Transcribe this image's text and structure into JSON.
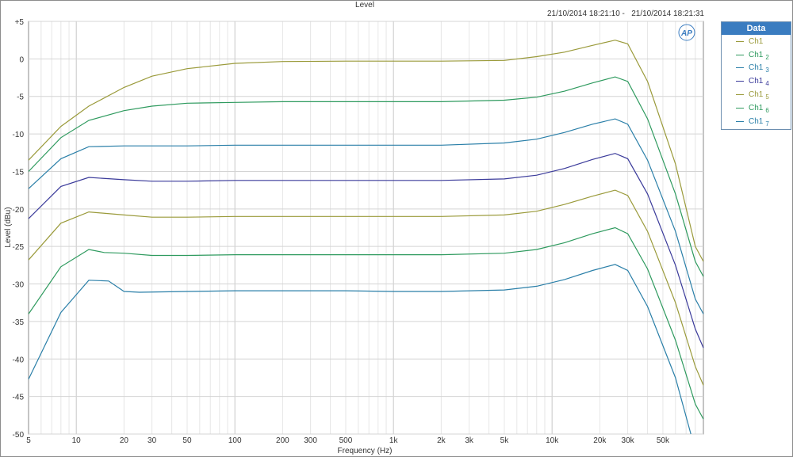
{
  "chart_data": {
    "type": "line",
    "title": "Level",
    "timestamp": "21/10/2014 18:21:10 -   21/10/2014 18:21:31",
    "xlabel": "Frequency (Hz)",
    "ylabel": "Level (dBu)",
    "xscale": "log",
    "xlim": [
      5,
      90000
    ],
    "ylim": [
      -50,
      5
    ],
    "grid": true,
    "legend_position": "right",
    "legend_title": "Data",
    "logo_text": "AP",
    "xticks": [
      {
        "v": 5,
        "label": "5"
      },
      {
        "v": 10,
        "label": "10"
      },
      {
        "v": 20,
        "label": "20"
      },
      {
        "v": 30,
        "label": "30"
      },
      {
        "v": 50,
        "label": "50"
      },
      {
        "v": 100,
        "label": "100"
      },
      {
        "v": 200,
        "label": "200"
      },
      {
        "v": 300,
        "label": "300"
      },
      {
        "v": 500,
        "label": "500"
      },
      {
        "v": 1000,
        "label": "1k"
      },
      {
        "v": 2000,
        "label": "2k"
      },
      {
        "v": 3000,
        "label": "3k"
      },
      {
        "v": 5000,
        "label": "5k"
      },
      {
        "v": 10000,
        "label": "10k"
      },
      {
        "v": 20000,
        "label": "20k"
      },
      {
        "v": 30000,
        "label": "30k"
      },
      {
        "v": 50000,
        "label": "50k"
      }
    ],
    "yticks": [
      {
        "v": 5,
        "label": "+5"
      },
      {
        "v": 0,
        "label": "0"
      },
      {
        "v": -5,
        "label": "-5"
      },
      {
        "v": -10,
        "label": "-10"
      },
      {
        "v": -15,
        "label": "-15"
      },
      {
        "v": -20,
        "label": "-20"
      },
      {
        "v": -25,
        "label": "-25"
      },
      {
        "v": -30,
        "label": "-30"
      },
      {
        "v": -35,
        "label": "-35"
      },
      {
        "v": -40,
        "label": "-40"
      },
      {
        "v": -45,
        "label": "-45"
      },
      {
        "v": -50,
        "label": "-50"
      }
    ],
    "series": [
      {
        "name": "Ch1",
        "sub": "",
        "color": "#9a9a3a",
        "points": [
          [
            5,
            -13.5
          ],
          [
            8,
            -9
          ],
          [
            12,
            -6.3
          ],
          [
            20,
            -3.8
          ],
          [
            30,
            -2.3
          ],
          [
            50,
            -1.3
          ],
          [
            100,
            -0.6
          ],
          [
            200,
            -0.35
          ],
          [
            500,
            -0.3
          ],
          [
            1000,
            -0.3
          ],
          [
            2000,
            -0.3
          ],
          [
            5000,
            -0.2
          ],
          [
            8000,
            0.3
          ],
          [
            12000,
            0.9
          ],
          [
            18000,
            1.8
          ],
          [
            25000,
            2.5
          ],
          [
            30000,
            2.0
          ],
          [
            40000,
            -3
          ],
          [
            60000,
            -14
          ],
          [
            80000,
            -25
          ],
          [
            90000,
            -27
          ]
        ]
      },
      {
        "name": "Ch1",
        "sub": "2",
        "color": "#2e9a5e",
        "points": [
          [
            5,
            -15
          ],
          [
            8,
            -10.5
          ],
          [
            12,
            -8.2
          ],
          [
            20,
            -6.9
          ],
          [
            30,
            -6.3
          ],
          [
            50,
            -5.9
          ],
          [
            100,
            -5.8
          ],
          [
            200,
            -5.7
          ],
          [
            500,
            -5.7
          ],
          [
            1000,
            -5.7
          ],
          [
            2000,
            -5.7
          ],
          [
            5000,
            -5.5
          ],
          [
            8000,
            -5.1
          ],
          [
            12000,
            -4.3
          ],
          [
            18000,
            -3.2
          ],
          [
            25000,
            -2.4
          ],
          [
            30000,
            -3
          ],
          [
            40000,
            -8
          ],
          [
            60000,
            -18
          ],
          [
            80000,
            -27
          ],
          [
            90000,
            -29
          ]
        ]
      },
      {
        "name": "Ch1",
        "sub": "3",
        "color": "#2a7fa8",
        "points": [
          [
            5,
            -17.3
          ],
          [
            8,
            -13.3
          ],
          [
            12,
            -11.7
          ],
          [
            20,
            -11.6
          ],
          [
            50,
            -11.6
          ],
          [
            100,
            -11.5
          ],
          [
            500,
            -11.5
          ],
          [
            1000,
            -11.5
          ],
          [
            2000,
            -11.5
          ],
          [
            5000,
            -11.2
          ],
          [
            8000,
            -10.7
          ],
          [
            12000,
            -9.8
          ],
          [
            18000,
            -8.7
          ],
          [
            25000,
            -8
          ],
          [
            30000,
            -8.7
          ],
          [
            40000,
            -13.5
          ],
          [
            60000,
            -23
          ],
          [
            80000,
            -32
          ],
          [
            90000,
            -34
          ]
        ]
      },
      {
        "name": "Ch1",
        "sub": "4",
        "color": "#3a3a9a",
        "points": [
          [
            5,
            -21.3
          ],
          [
            8,
            -17
          ],
          [
            12,
            -15.8
          ],
          [
            20,
            -16.1
          ],
          [
            30,
            -16.3
          ],
          [
            50,
            -16.3
          ],
          [
            100,
            -16.2
          ],
          [
            500,
            -16.2
          ],
          [
            1000,
            -16.2
          ],
          [
            2000,
            -16.2
          ],
          [
            5000,
            -16
          ],
          [
            8000,
            -15.5
          ],
          [
            12000,
            -14.6
          ],
          [
            18000,
            -13.4
          ],
          [
            25000,
            -12.6
          ],
          [
            30000,
            -13.3
          ],
          [
            40000,
            -18
          ],
          [
            60000,
            -27.5
          ],
          [
            80000,
            -36
          ],
          [
            90000,
            -38.5
          ]
        ]
      },
      {
        "name": "Ch1",
        "sub": "5",
        "color": "#9a9a3a",
        "points": [
          [
            5,
            -26.8
          ],
          [
            8,
            -21.9
          ],
          [
            12,
            -20.4
          ],
          [
            20,
            -20.8
          ],
          [
            30,
            -21.1
          ],
          [
            50,
            -21.1
          ],
          [
            100,
            -21
          ],
          [
            500,
            -21
          ],
          [
            1000,
            -21
          ],
          [
            2000,
            -21
          ],
          [
            5000,
            -20.8
          ],
          [
            8000,
            -20.3
          ],
          [
            12000,
            -19.4
          ],
          [
            18000,
            -18.3
          ],
          [
            25000,
            -17.5
          ],
          [
            30000,
            -18.2
          ],
          [
            40000,
            -23
          ],
          [
            60000,
            -32.5
          ],
          [
            80000,
            -41
          ],
          [
            90000,
            -43.5
          ]
        ]
      },
      {
        "name": "Ch1",
        "sub": "6",
        "color": "#2e9a5e",
        "points": [
          [
            5,
            -34
          ],
          [
            8,
            -27.7
          ],
          [
            12,
            -25.4
          ],
          [
            15,
            -25.8
          ],
          [
            20,
            -25.9
          ],
          [
            30,
            -26.2
          ],
          [
            50,
            -26.2
          ],
          [
            100,
            -26.1
          ],
          [
            500,
            -26.1
          ],
          [
            1000,
            -26.1
          ],
          [
            2000,
            -26.1
          ],
          [
            5000,
            -25.9
          ],
          [
            8000,
            -25.4
          ],
          [
            12000,
            -24.5
          ],
          [
            18000,
            -23.3
          ],
          [
            25000,
            -22.5
          ],
          [
            30000,
            -23.3
          ],
          [
            40000,
            -28
          ],
          [
            60000,
            -37.5
          ],
          [
            80000,
            -46
          ],
          [
            90000,
            -48
          ]
        ]
      },
      {
        "name": "Ch1",
        "sub": "7",
        "color": "#2a7fa8",
        "points": [
          [
            5,
            -42.7
          ],
          [
            8,
            -33.8
          ],
          [
            12,
            -29.5
          ],
          [
            16,
            -29.6
          ],
          [
            20,
            -31
          ],
          [
            25,
            -31.1
          ],
          [
            50,
            -31
          ],
          [
            100,
            -30.9
          ],
          [
            500,
            -30.9
          ],
          [
            1000,
            -31
          ],
          [
            2000,
            -31
          ],
          [
            5000,
            -30.8
          ],
          [
            8000,
            -30.3
          ],
          [
            12000,
            -29.4
          ],
          [
            18000,
            -28.2
          ],
          [
            25000,
            -27.4
          ],
          [
            30000,
            -28.2
          ],
          [
            40000,
            -33
          ],
          [
            60000,
            -42.5
          ],
          [
            75000,
            -50
          ]
        ]
      }
    ]
  }
}
